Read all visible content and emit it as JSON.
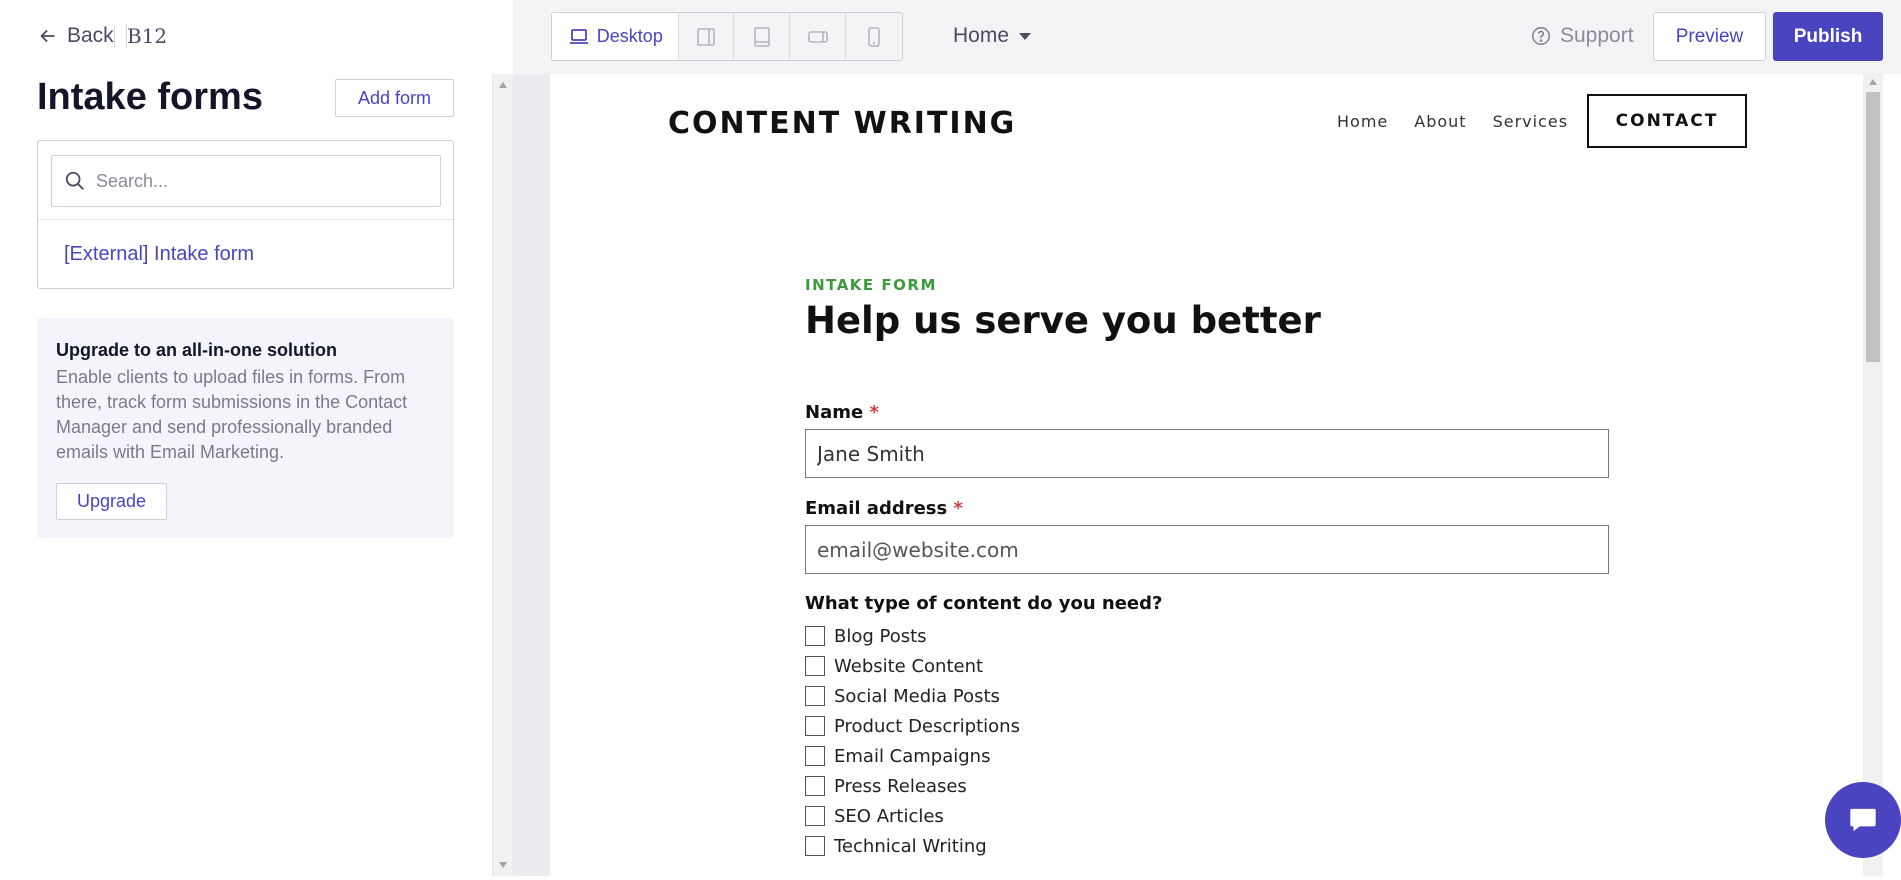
{
  "nav": {
    "back_label": "Back",
    "brand": "B12"
  },
  "left_panel": {
    "title": "Intake forms",
    "add_form_label": "Add form",
    "search_placeholder": "Search...",
    "forms": [
      "[External] Intake form"
    ],
    "upgrade": {
      "title": "Upgrade to an all-in-one solution",
      "text": "Enable clients to upload files in forms. From there, track form submissions in the Contact Manager and send professionally branded emails with Email Marketing.",
      "button_label": "Upgrade"
    }
  },
  "toolbar": {
    "device_active_label": "Desktop",
    "page_selected": "Home",
    "support_label": "Support",
    "preview_label": "Preview",
    "publish_label": "Publish"
  },
  "site": {
    "logo": "CONTENT WRITING",
    "nav": [
      "Home",
      "About",
      "Services"
    ],
    "contact_label": "CONTACT",
    "form": {
      "eyebrow": "INTAKE FORM",
      "headline": "Help us serve you better",
      "name_label": "Name",
      "name_value": "Jane Smith",
      "email_label": "Email address",
      "email_placeholder": "email@website.com",
      "required_mark": "*",
      "content_question": "What type of content do you need?",
      "content_options": [
        "Blog Posts",
        "Website Content",
        "Social Media Posts",
        "Product Descriptions",
        "Email Campaigns",
        "Press Releases",
        "SEO Articles",
        "Technical Writing"
      ]
    }
  },
  "colors": {
    "accent": "#4b44c0",
    "eyebrow": "#3c9a3c",
    "required": "#d04040",
    "upgrade_bg": "#f4f4fb"
  }
}
